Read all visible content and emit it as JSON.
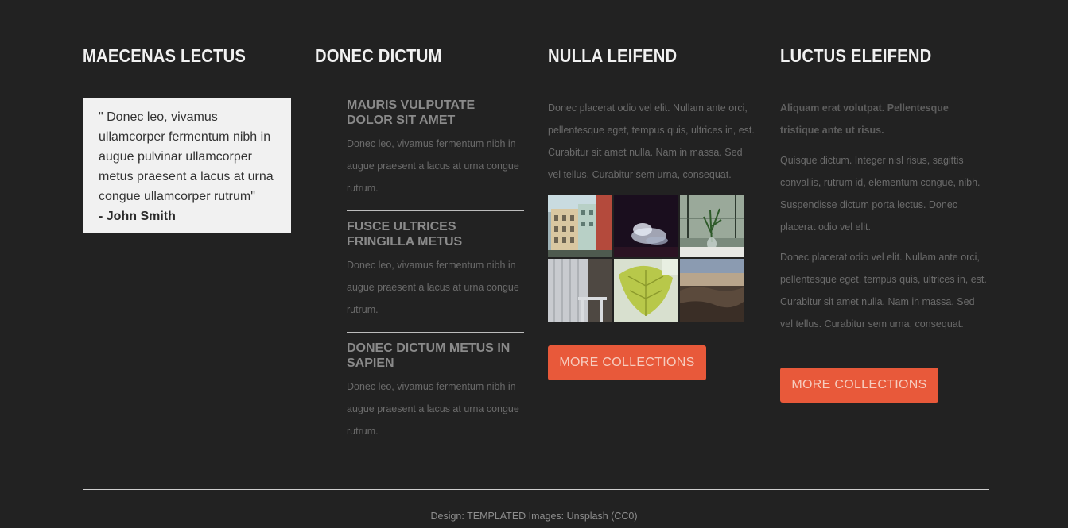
{
  "columns": [
    {
      "title": "MAECENAS LECTUS"
    },
    {
      "title": "DONEC DICTUM"
    },
    {
      "title": "NULLA LEIFEND"
    },
    {
      "title": "LUCTUS ELEIFEND"
    }
  ],
  "quote": {
    "text": "\" Donec leo, vivamus ullamcorper fermentum nibh in augue pulvinar ullamcorper metus praesent a lacus at urna congue ullamcorper rutrum\"",
    "author": "- John Smith"
  },
  "features": [
    {
      "title": "MAURIS VULPUTATE DOLOR SIT AMET",
      "text": "Donec leo, vivamus fermentum nibh in augue praesent a lacus at urna congue rutrum."
    },
    {
      "title": "FUSCE ULTRICES FRINGILLA METUS",
      "text": "Donec leo, vivamus fermentum nibh in augue praesent a lacus at urna congue rutrum."
    },
    {
      "title": "DONEC DICTUM METUS IN SAPIEN",
      "text": "Donec leo, vivamus fermentum nibh in augue praesent a lacus at urna congue rutrum."
    }
  ],
  "collection": {
    "text": "Donec placerat odio vel elit. Nullam ante orci, pellentesque eget, tempus quis, ultrices in, est. Curabitur sit amet nulla. Nam in massa. Sed vel tellus. Curabitur sem urna, consequat.",
    "button_label": "MORE COLLECTIONS",
    "gallery": [
      {
        "name": "city-buildings-image"
      },
      {
        "name": "smoke-image"
      },
      {
        "name": "plant-window-image"
      },
      {
        "name": "curtain-chair-image"
      },
      {
        "name": "leaf-image"
      },
      {
        "name": "landscape-image"
      }
    ]
  },
  "luctus": {
    "lead": "Aliquam erat volutpat. Pellentesque tristique ante ut risus.",
    "para1": "Quisque dictum. Integer nisl risus, sagittis convallis, rutrum id, elementum congue, nibh. Suspendisse dictum porta lectus. Donec placerat odio vel elit.",
    "para2": "Donec placerat odio vel elit. Nullam ante orci, pellentesque eget, tempus quis, ultrices in, est. Curabitur sit amet nulla. Nam in massa. Sed vel tellus. Curabitur sem urna, consequat.",
    "button_label": "MORE COLLECTIONS"
  },
  "footer": {
    "credit": "Design: TEMPLATED Images: Unsplash (CC0)"
  },
  "colors": {
    "background": "#222222",
    "accent": "#e8593a",
    "quote_bg": "#f1f1f1"
  }
}
